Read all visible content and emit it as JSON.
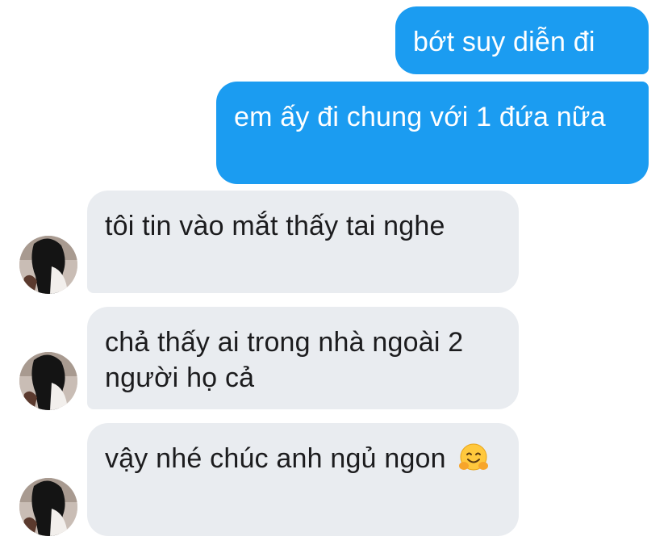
{
  "conversation": {
    "messages": [
      {
        "side": "outgoing",
        "text": "bớt suy diễn đi"
      },
      {
        "side": "outgoing",
        "text": "em ấy đi chung với 1 đứa nữa"
      },
      {
        "side": "incoming",
        "text": "tôi tin vào mắt thấy tai nghe"
      },
      {
        "side": "incoming",
        "text": "chả thấy ai trong nhà ngoài 2 người họ cả"
      },
      {
        "side": "incoming",
        "text": "vậy nhé chúc anh ngủ ngon",
        "emoji": "hugging-face-icon"
      }
    ]
  },
  "colors": {
    "outgoing_bubble": "#1b9cf1",
    "incoming_bubble": "#e9ecf0",
    "background": "#ffffff"
  }
}
